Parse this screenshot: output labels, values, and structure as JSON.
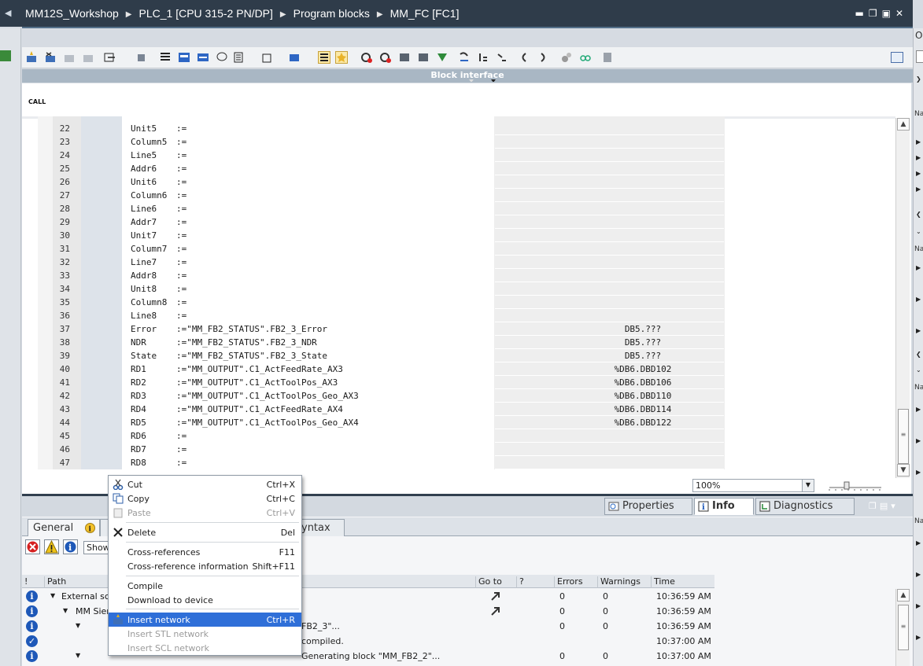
{
  "titlebar": {
    "breadcrumb": [
      "MM12S_Workshop",
      "PLC_1 [CPU 315-2 PN/DP]",
      "Program blocks",
      "MM_FC [FC1]"
    ]
  },
  "block_interface": {
    "label": "Block interface"
  },
  "call_label": "CALL",
  "code_lines": [
    {
      "n": "22",
      "param": "Unit5",
      "assign": ":=",
      "addr": ""
    },
    {
      "n": "23",
      "param": "Column5",
      "assign": ":=",
      "addr": ""
    },
    {
      "n": "24",
      "param": "Line5",
      "assign": ":=",
      "addr": ""
    },
    {
      "n": "25",
      "param": "Addr6",
      "assign": ":=",
      "addr": ""
    },
    {
      "n": "26",
      "param": "Unit6",
      "assign": ":=",
      "addr": ""
    },
    {
      "n": "27",
      "param": "Column6",
      "assign": ":=",
      "addr": ""
    },
    {
      "n": "28",
      "param": "Line6",
      "assign": ":=",
      "addr": ""
    },
    {
      "n": "29",
      "param": "Addr7",
      "assign": ":=",
      "addr": ""
    },
    {
      "n": "30",
      "param": "Unit7",
      "assign": ":=",
      "addr": ""
    },
    {
      "n": "31",
      "param": "Column7",
      "assign": ":=",
      "addr": ""
    },
    {
      "n": "32",
      "param": "Line7",
      "assign": ":=",
      "addr": ""
    },
    {
      "n": "33",
      "param": "Addr8",
      "assign": ":=",
      "addr": ""
    },
    {
      "n": "34",
      "param": "Unit8",
      "assign": ":=",
      "addr": ""
    },
    {
      "n": "35",
      "param": "Column8",
      "assign": ":=",
      "addr": ""
    },
    {
      "n": "36",
      "param": "Line8",
      "assign": ":=",
      "addr": ""
    },
    {
      "n": "37",
      "param": "Error",
      "assign": ":=\"MM_FB2_STATUS\".FB2_3_Error",
      "addr": "DB5.???"
    },
    {
      "n": "38",
      "param": "NDR",
      "assign": ":=\"MM_FB2_STATUS\".FB2_3_NDR",
      "addr": "DB5.???"
    },
    {
      "n": "39",
      "param": "State",
      "assign": ":=\"MM_FB2_STATUS\".FB2_3_State",
      "addr": "DB5.???"
    },
    {
      "n": "40",
      "param": "RD1",
      "assign": ":=\"MM_OUTPUT\".C1_ActFeedRate_AX3",
      "addr": "%DB6.DBD102"
    },
    {
      "n": "41",
      "param": "RD2",
      "assign": ":=\"MM_OUTPUT\".C1_ActToolPos_AX3",
      "addr": "%DB6.DBD106"
    },
    {
      "n": "42",
      "param": "RD3",
      "assign": ":=\"MM_OUTPUT\".C1_ActToolPos_Geo_AX3",
      "addr": "%DB6.DBD110"
    },
    {
      "n": "43",
      "param": "RD4",
      "assign": ":=\"MM_OUTPUT\".C1_ActFeedRate_AX4",
      "addr": "%DB6.DBD114"
    },
    {
      "n": "44",
      "param": "RD5",
      "assign": ":=\"MM_OUTPUT\".C1_ActToolPos_Geo_AX4",
      "addr": "%DB6.DBD122"
    },
    {
      "n": "45",
      "param": "RD6",
      "assign": ":=",
      "addr": ""
    },
    {
      "n": "46",
      "param": "RD7",
      "assign": ":=",
      "addr": ""
    },
    {
      "n": "47",
      "param": "RD8",
      "assign": ":=",
      "addr": ""
    }
  ],
  "zoom": {
    "value": "100%"
  },
  "inspector_tabs": [
    {
      "label": "Properties",
      "active": false
    },
    {
      "label": "Info",
      "active": true
    },
    {
      "label": "Diagnostics",
      "active": false
    }
  ],
  "subtabs": {
    "general": "General",
    "syntax_partial": "yntax"
  },
  "filter": {
    "show_label": "Show"
  },
  "msg_columns": {
    "flag": "!",
    "path": "Path",
    "goto": "Go to",
    "q": "?",
    "errors": "Errors",
    "warnings": "Warnings",
    "time": "Time"
  },
  "messages": [
    {
      "path": "External sc",
      "desc": "",
      "errors": "0",
      "warnings": "0",
      "time": "10:36:59 AM",
      "goto": true,
      "icon": "info"
    },
    {
      "path": "MM Sier",
      "desc": "",
      "errors": "0",
      "warnings": "0",
      "time": "10:36:59 AM",
      "goto": true,
      "icon": "info"
    },
    {
      "path": "",
      "desc": "FB2_3\"...",
      "errors": "0",
      "warnings": "0",
      "time": "10:36:59 AM",
      "goto": false,
      "icon": "info"
    },
    {
      "path": "",
      "desc": "compiled.",
      "errors": "",
      "warnings": "",
      "time": "10:37:00 AM",
      "goto": false,
      "icon": "ok"
    },
    {
      "path": "",
      "desc": "Generating block \"MM_FB2_2\"...",
      "errors": "0",
      "warnings": "0",
      "time": "10:37:00 AM",
      "goto": false,
      "icon": "info"
    }
  ],
  "context_menu": {
    "items": [
      {
        "label": "Cut",
        "shortcut": "Ctrl+X",
        "disabled": false,
        "icon": "scissors-icon"
      },
      {
        "label": "Copy",
        "shortcut": "Ctrl+C",
        "disabled": false,
        "icon": "copy-icon"
      },
      {
        "label": "Paste",
        "shortcut": "Ctrl+V",
        "disabled": true,
        "icon": "paste-icon"
      },
      {
        "label": "Delete",
        "shortcut": "Del",
        "disabled": false,
        "icon": "delete-icon"
      },
      {
        "label": "Cross-references",
        "shortcut": "F11",
        "disabled": false,
        "icon": ""
      },
      {
        "label": "Cross-reference information",
        "shortcut": "Shift+F11",
        "disabled": false,
        "icon": ""
      },
      {
        "label": "Compile",
        "shortcut": "",
        "disabled": false,
        "icon": ""
      },
      {
        "label": "Download to device",
        "shortcut": "",
        "disabled": false,
        "icon": ""
      },
      {
        "label": "Insert network",
        "shortcut": "Ctrl+R",
        "disabled": false,
        "highlighted": true,
        "icon": "insert-network-icon"
      },
      {
        "label": "Insert STL network",
        "shortcut": "",
        "disabled": true,
        "icon": ""
      },
      {
        "label": "Insert SCL network",
        "shortcut": "",
        "disabled": true,
        "icon": ""
      }
    ]
  },
  "right_panel": {
    "top_letter": "O",
    "na_label": "Na"
  },
  "colors": {
    "titlebar": "#2f3c4a",
    "highlight": "#2f6fd8",
    "info_blue": "#1e58b8"
  }
}
